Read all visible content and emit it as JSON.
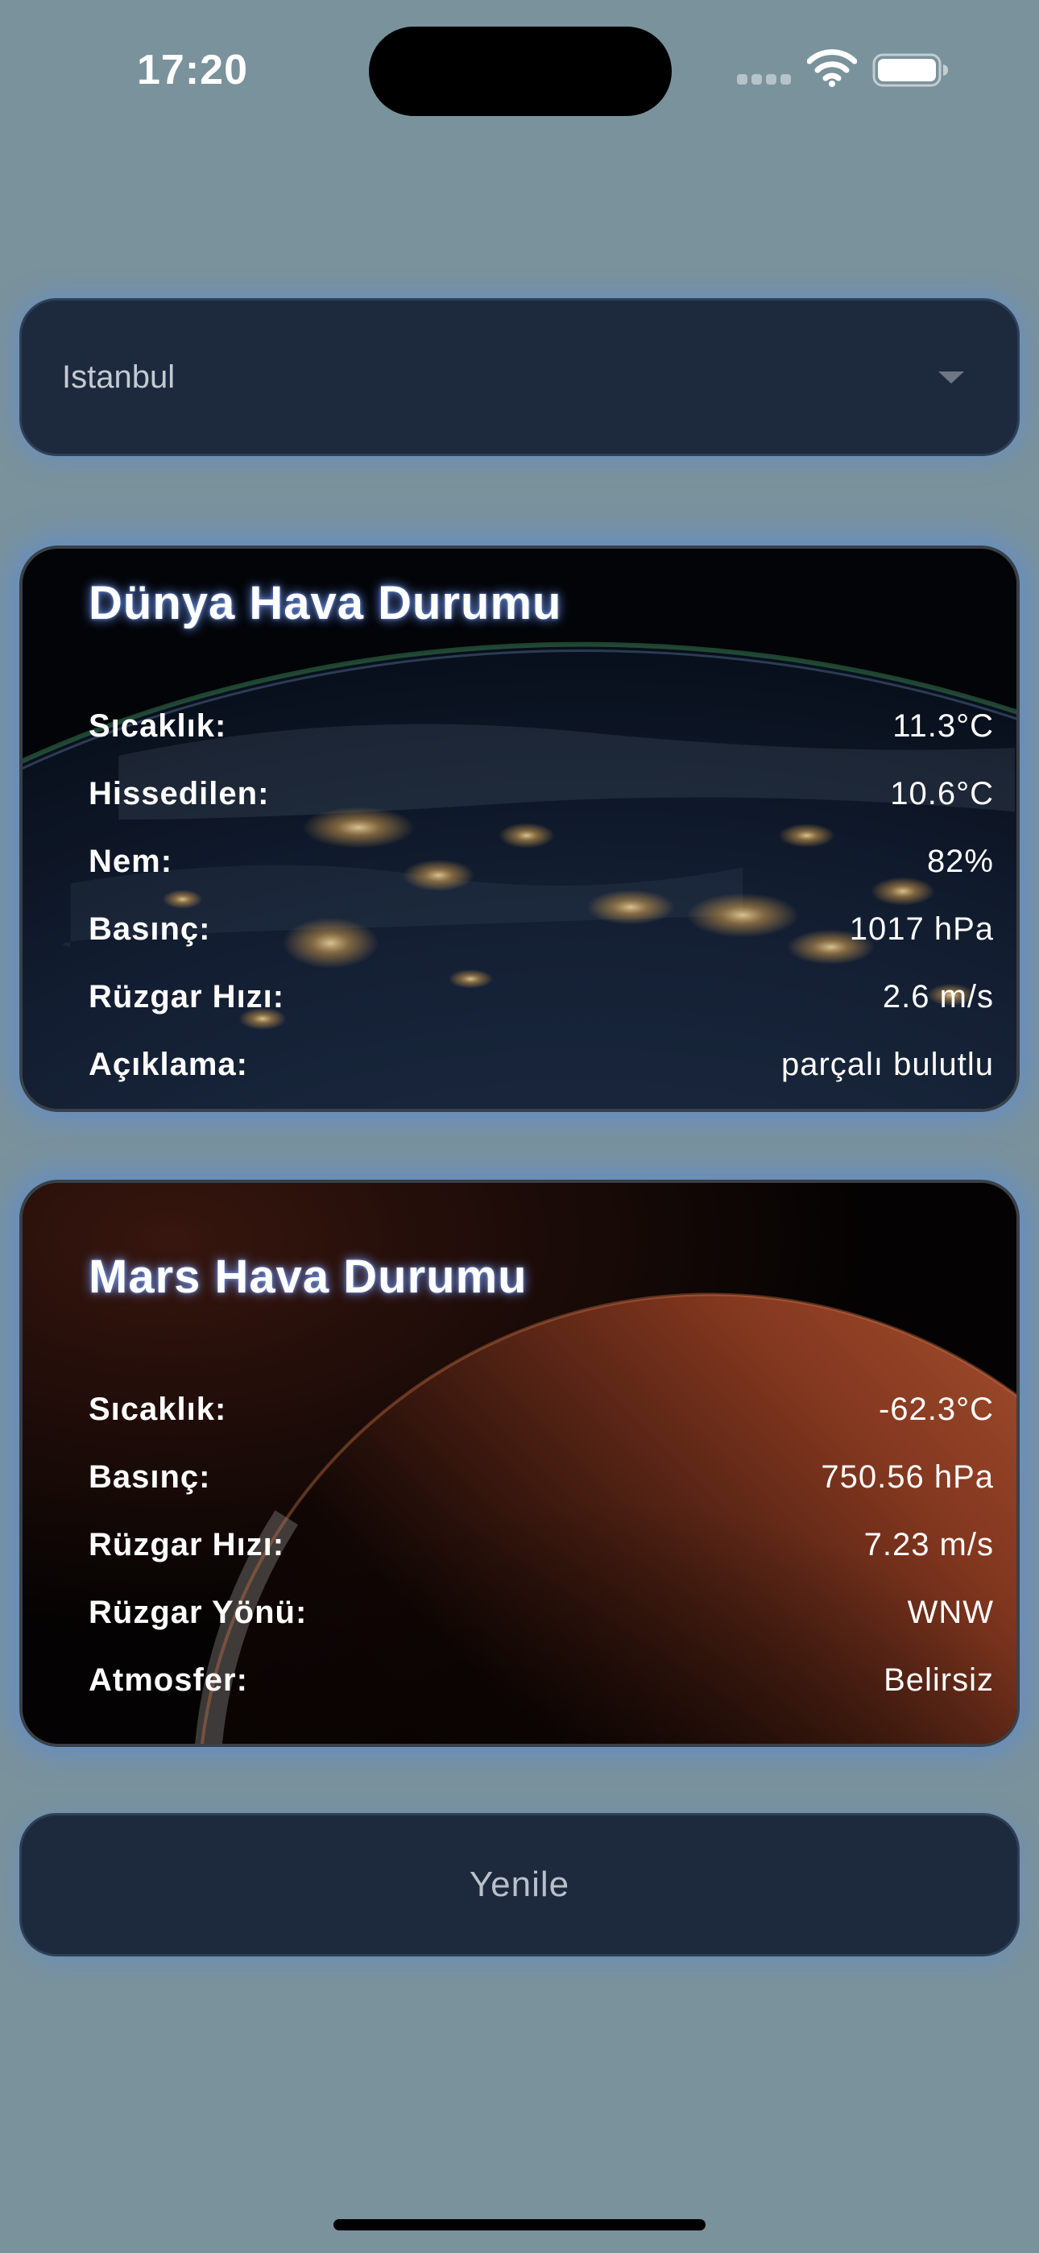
{
  "status_bar": {
    "time": "17:20"
  },
  "city_select": {
    "value": "Istanbul",
    "icon": "chevron-down-icon"
  },
  "earth": {
    "title": "Dünya Hava Durumu",
    "rows": [
      {
        "label": "Sıcaklık:",
        "value": "11.3°C"
      },
      {
        "label": "Hissedilen:",
        "value": "10.6°C"
      },
      {
        "label": "Nem:",
        "value": "82%"
      },
      {
        "label": "Basınç:",
        "value": "1017 hPa"
      },
      {
        "label": "Rüzgar Hızı:",
        "value": "2.6 m/s"
      },
      {
        "label": "Açıklama:",
        "value": "parçalı bulutlu"
      }
    ]
  },
  "mars": {
    "title": "Mars Hava Durumu",
    "rows": [
      {
        "label": "Sıcaklık:",
        "value": "-62.3°C"
      },
      {
        "label": "Basınç:",
        "value": "750.56 hPa"
      },
      {
        "label": "Rüzgar Hızı:",
        "value": "7.23 m/s"
      },
      {
        "label": "Rüzgar Yönü:",
        "value": "WNW"
      },
      {
        "label": "Atmosfer:",
        "value": "Belirsiz"
      }
    ]
  },
  "refresh_button": {
    "label": "Yenile"
  },
  "colors": {
    "page_background": "#7a929c",
    "control_background": "#1d2a3d",
    "glow": "#608ccd",
    "text": "#ffffff"
  }
}
